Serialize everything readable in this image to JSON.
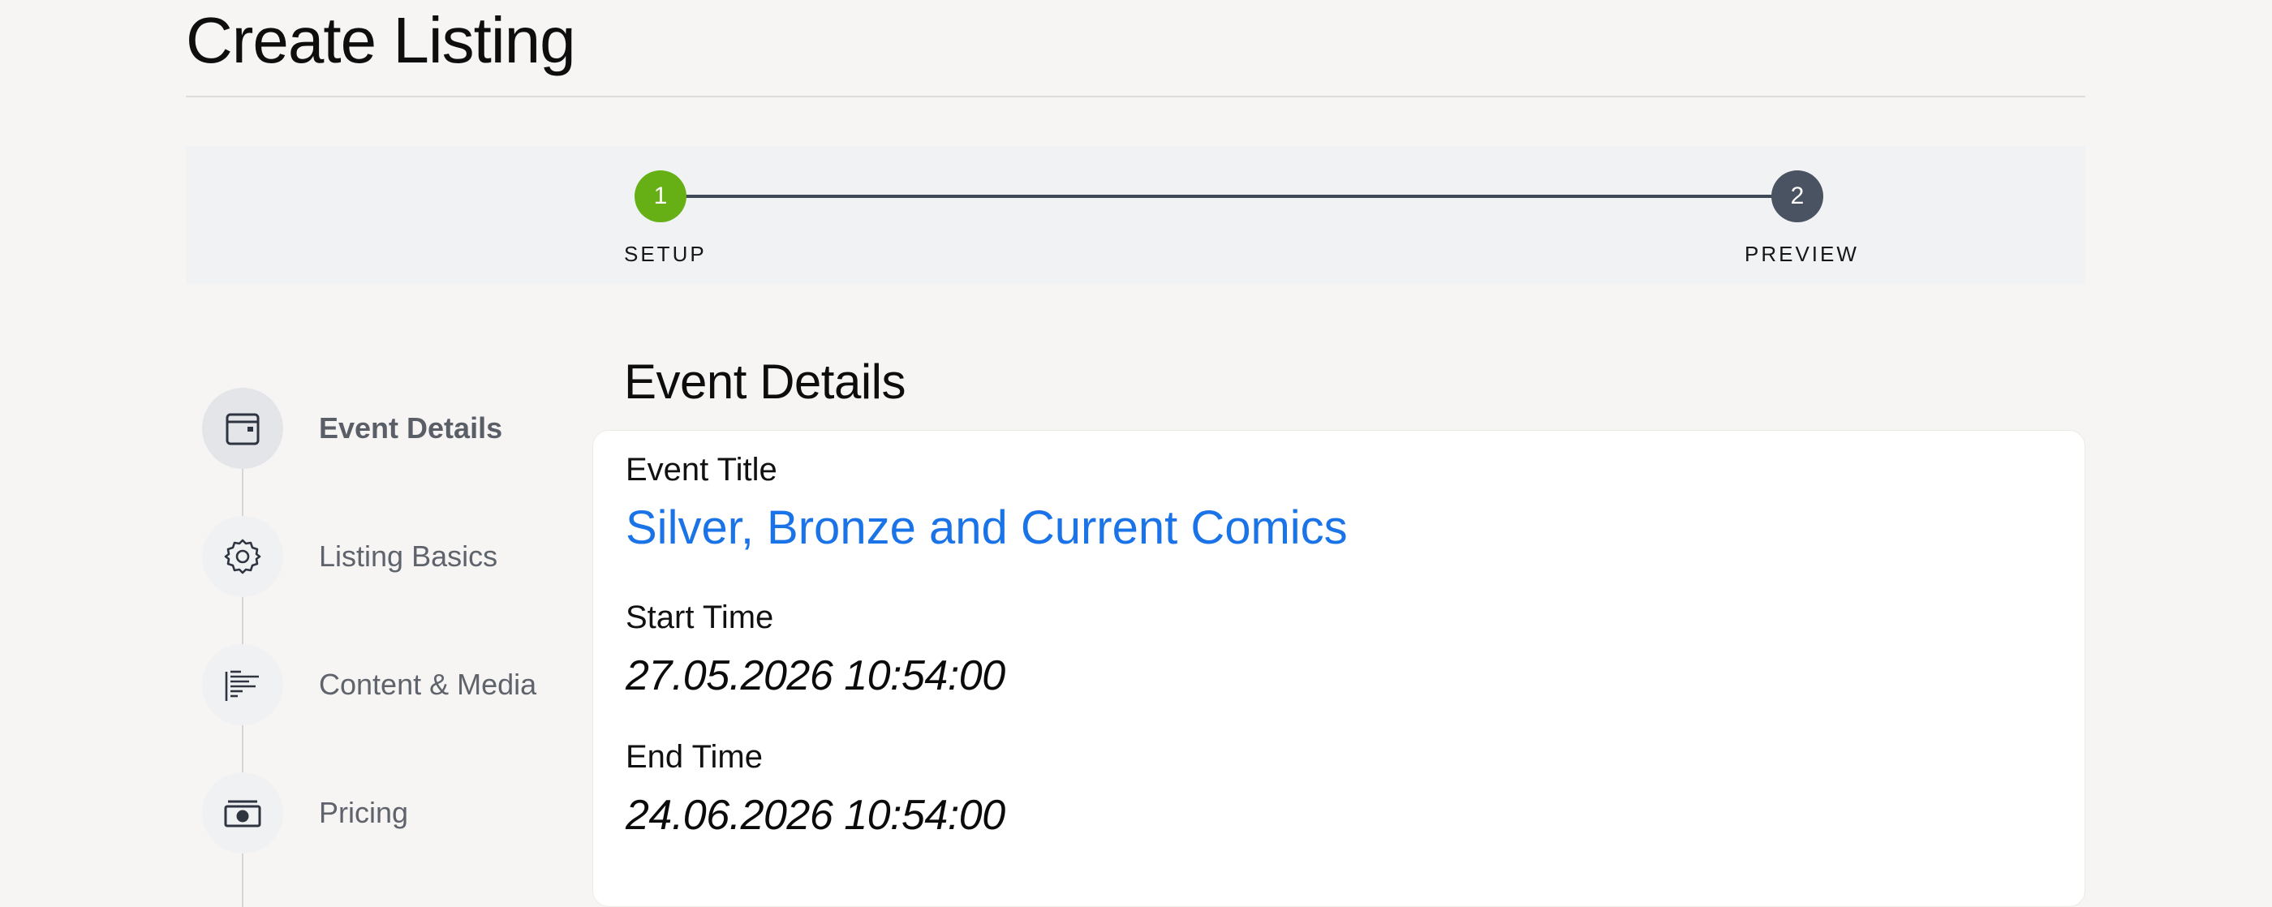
{
  "page": {
    "title": "Create Listing"
  },
  "stepper": {
    "steps": [
      {
        "number": "1",
        "label": "SETUP",
        "color": "#66b016"
      },
      {
        "number": "2",
        "label": "PREVIEW",
        "color": "#4a5362"
      }
    ]
  },
  "sidebar": {
    "items": [
      {
        "label": "Event Details",
        "icon": "calendar-icon",
        "active": true
      },
      {
        "label": "Listing Basics",
        "icon": "gear-icon",
        "active": false
      },
      {
        "label": "Content & Media",
        "icon": "text-lines-icon",
        "active": false
      },
      {
        "label": "Pricing",
        "icon": "banknote-icon",
        "active": false
      }
    ]
  },
  "section": {
    "title": "Event Details",
    "fields": {
      "event_title": {
        "label": "Event Title",
        "value": "Silver, Bronze and Current Comics"
      },
      "start_time": {
        "label": "Start Time",
        "value": "27.05.2026 10:54:00"
      },
      "end_time": {
        "label": "End Time",
        "value": "24.06.2026 10:54:00"
      }
    }
  },
  "colors": {
    "accent_link": "#1b73e8",
    "step_done": "#66b016",
    "step_pending": "#4a5362"
  }
}
